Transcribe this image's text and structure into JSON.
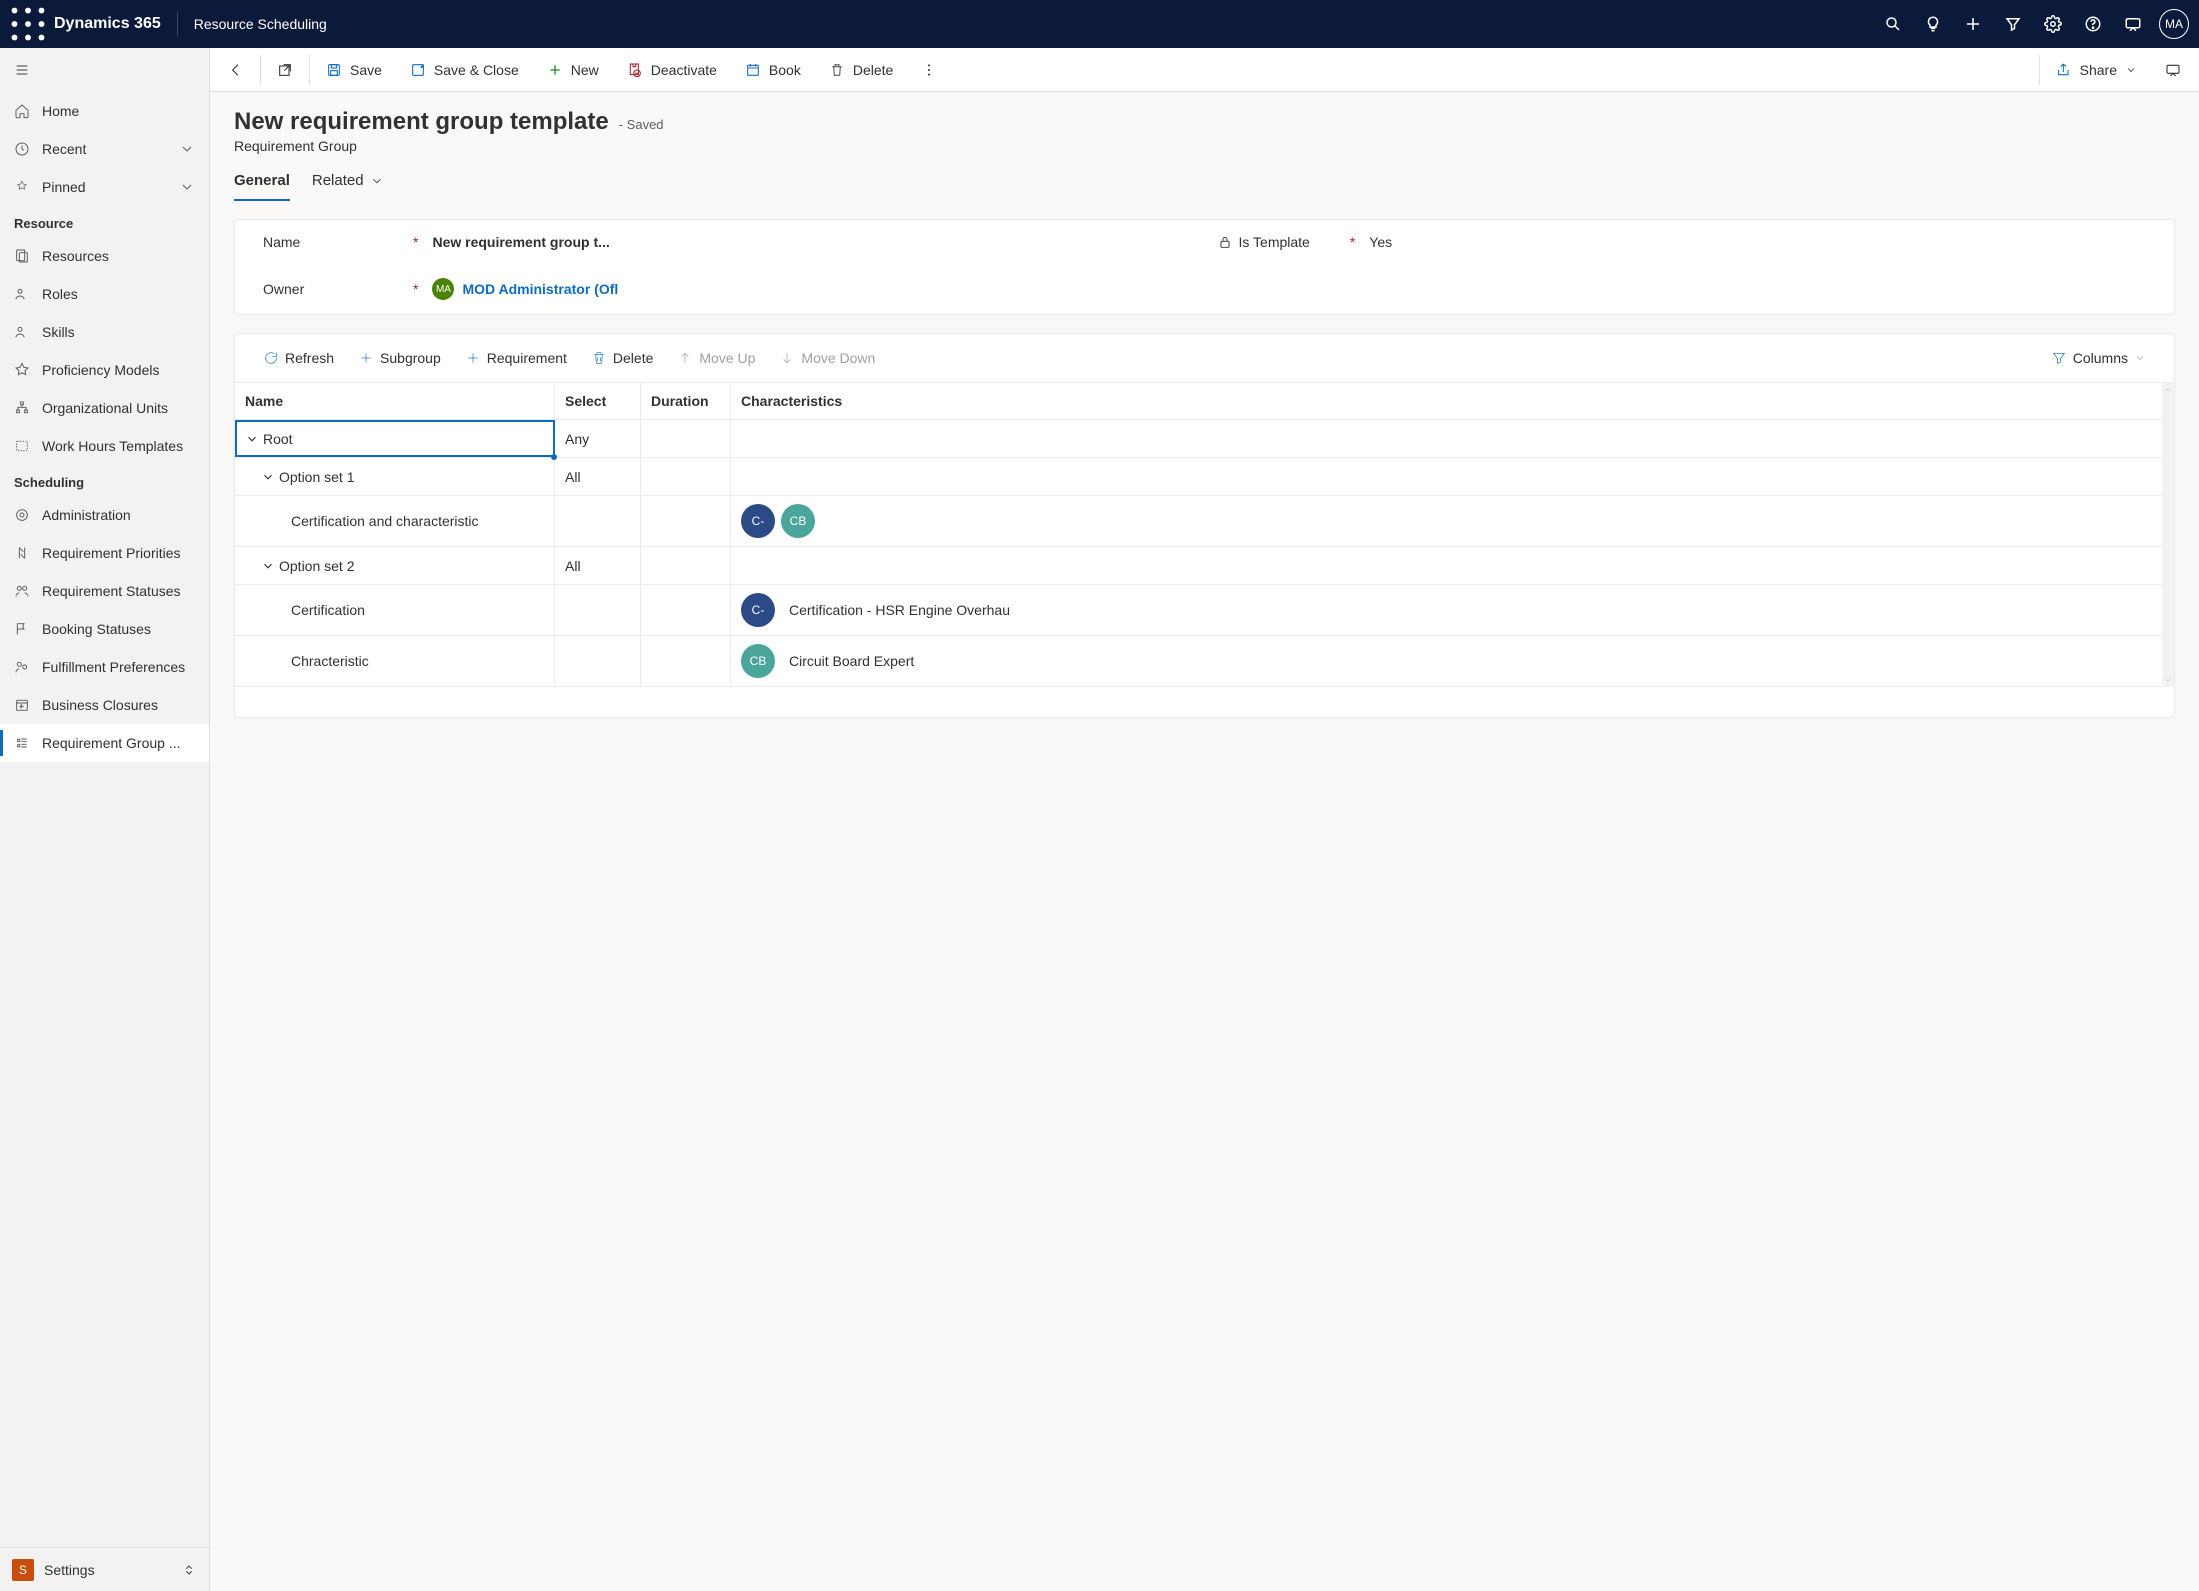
{
  "header": {
    "brand": "Dynamics 365",
    "app": "Resource Scheduling",
    "user_initials": "MA"
  },
  "sidebar": {
    "home": "Home",
    "recent": "Recent",
    "pinned": "Pinned",
    "group_resource": "Resource",
    "resource_items": [
      "Resources",
      "Roles",
      "Skills",
      "Proficiency Models",
      "Organizational Units",
      "Work Hours Templates"
    ],
    "group_scheduling": "Scheduling",
    "scheduling_items": [
      "Administration",
      "Requirement Priorities",
      "Requirement Statuses",
      "Booking Statuses",
      "Fulfillment Preferences",
      "Business Closures",
      "Requirement Group ..."
    ],
    "area": {
      "badge": "S",
      "label": "Settings"
    }
  },
  "cmdbar": {
    "save": "Save",
    "save_close": "Save & Close",
    "new": "New",
    "deactivate": "Deactivate",
    "book": "Book",
    "delete": "Delete",
    "share": "Share"
  },
  "page": {
    "title": "New requirement group template",
    "status": "- Saved",
    "subtitle": "Requirement Group",
    "tabs": {
      "general": "General",
      "related": "Related"
    }
  },
  "form": {
    "name_label": "Name",
    "name_value": "New requirement group t...",
    "is_template_label": "Is Template",
    "is_template_value": "Yes",
    "owner_label": "Owner",
    "owner_value": "MOD Administrator (Ofl",
    "owner_initials": "MA"
  },
  "subcmd": {
    "refresh": "Refresh",
    "subgroup": "Subgroup",
    "requirement": "Requirement",
    "delete": "Delete",
    "moveup": "Move Up",
    "movedown": "Move Down",
    "columns": "Columns"
  },
  "table": {
    "cols": {
      "name": "Name",
      "select": "Select",
      "duration": "Duration",
      "char": "Characteristics"
    },
    "rows": [
      {
        "indent": 0,
        "expand": true,
        "name": "Root",
        "select": "Any",
        "duration": "",
        "chips": [],
        "char_text": "",
        "selected": true
      },
      {
        "indent": 1,
        "expand": true,
        "name": "Option set 1",
        "select": "All",
        "duration": "",
        "chips": [],
        "char_text": ""
      },
      {
        "indent": 2,
        "expand": false,
        "name": "Certification and characteristic",
        "select": "",
        "duration": "",
        "chips": [
          {
            "t": "C-",
            "c": "blue"
          },
          {
            "t": "CB",
            "c": "teal"
          }
        ],
        "char_text": ""
      },
      {
        "indent": 1,
        "expand": true,
        "name": "Option set 2",
        "select": "All",
        "duration": "",
        "chips": [],
        "char_text": ""
      },
      {
        "indent": 2,
        "expand": false,
        "name": "Certification",
        "select": "",
        "duration": "",
        "chips": [
          {
            "t": "C-",
            "c": "blue"
          }
        ],
        "char_text": "Certification - HSR Engine Overhau"
      },
      {
        "indent": 2,
        "expand": false,
        "name": "Chracteristic",
        "select": "",
        "duration": "",
        "chips": [
          {
            "t": "CB",
            "c": "teal"
          }
        ],
        "char_text": "Circuit Board Expert"
      }
    ]
  }
}
